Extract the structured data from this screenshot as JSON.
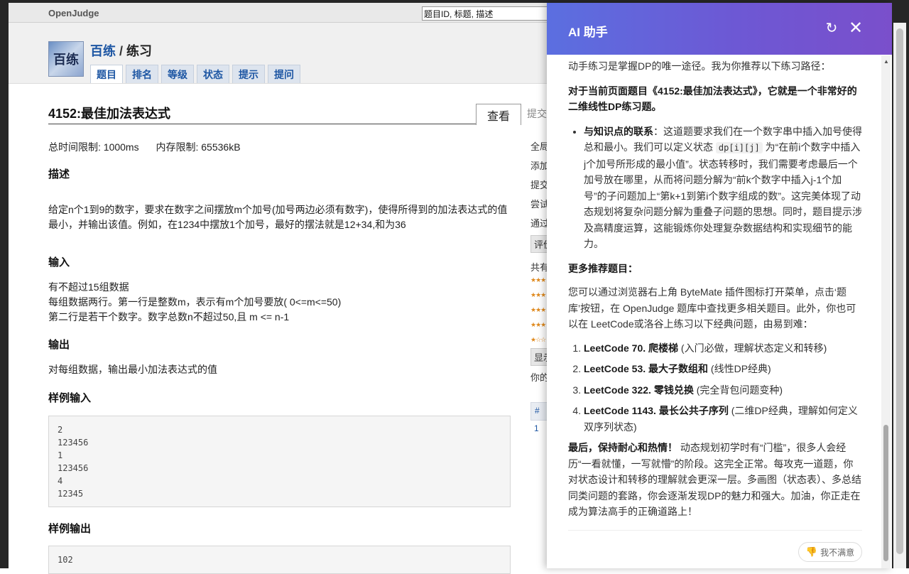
{
  "site": {
    "brand": "OpenJudge",
    "search_placeholder": "题目ID, 标题, 描述"
  },
  "header": {
    "logo_text": "百练",
    "crumb_link": "百练",
    "crumb_sep": "/",
    "crumb_current": "练习",
    "tabs": [
      "题目",
      "排名",
      "等级",
      "状态",
      "提示",
      "提问"
    ]
  },
  "problem": {
    "title": "4152:最佳加法表达式",
    "view_tab": "查看",
    "next_tab": "提交",
    "time_limit": "总时间限制: 1000ms",
    "memory_limit": "内存限制: 65536kB",
    "desc_h": "描述",
    "desc": "给定n个1到9的数字，要求在数字之间摆放m个加号(加号两边必须有数字)，使得所得到的加法表达式的值最小，并输出该值。例如，在1234中摆放1个加号，最好的摆法就是12+34,和为36",
    "input_h": "输入",
    "input_lines": [
      "有不超过15组数据",
      "每组数据两行。第一行是整数m，表示有m个加号要放( 0<=m<=50)",
      "第二行是若干个数字。数字总数n不超过50,且 m <= n-1"
    ],
    "output_h": "输出",
    "output": "对每组数据，输出最小加法表达式的值",
    "sample_in_h": "样例输入",
    "sample_in": "2\n123456\n1\n123456\n4\n12345",
    "sample_out_h": "样例输出",
    "sample_out": "102"
  },
  "sidebar": {
    "lines": [
      "全局",
      "添加",
      "提交",
      "尝试",
      "通过"
    ],
    "eval_btn": "评价",
    "share_label": "共有",
    "show_btn": "显示",
    "yours_label": "你的",
    "table_head": "#",
    "table_row": "1"
  },
  "ai": {
    "title": "AI 助手",
    "refresh_icon": "↻",
    "close_icon": "✕",
    "intro": "动手练习是掌握DP的唯一途径。我为你推荐以下练习路径：",
    "current_bold": "对于当前页面题目《4152:最佳加法表达式》，它就是一个非常好的二维线性DP练习题。",
    "bullet_bold": "与知识点的联系",
    "bullet_a": "：这道题要求我们在一个数字串中插入加号使得总和最小。我们可以定义状态 ",
    "bullet_code": "dp[i][j]",
    "bullet_b": " 为“在前i个数字中插入j个加号所形成的最小值”。状态转移时，我们需要考虑最后一个加号放在哪里，从而将问题分解为“前k个数字中插入j-1个加号”的子问题加上“第k+1到第i个数字组成的数”。这完美体现了动态规划将复杂问题分解为重叠子问题的思想。同时，题目提示涉及高精度运算，这能锻炼你处理复杂数据结构和实现细节的能力。",
    "more_h": "更多推荐题目：",
    "more_text": "您可以通过浏览器右上角 ByteMate 插件图标打开菜单，点击‘题库’按钮，在 OpenJudge 题库中查找更多相关题目。此外，你也可以在 LeetCode或洛谷上练习以下经典问题，由易到难：",
    "list": [
      {
        "bold": "LeetCode 70. 爬楼梯",
        "rest": " (入门必做，理解状态定义和转移)"
      },
      {
        "bold": "LeetCode 53. 最大子数组和",
        "rest": " (线性DP经典)"
      },
      {
        "bold": "LeetCode 322. 零钱兑换",
        "rest": " (完全背包问题变种)"
      },
      {
        "bold": "LeetCode 1143. 最长公共子序列",
        "rest": " (二维DP经典，理解如何定义双序列状态)"
      }
    ],
    "final_bold": "最后，保持耐心和热情！",
    "final_text": " 动态规划初学时有“门槛”，很多人会经历“一看就懂，一写就懵”的阶段。这完全正常。每攻克一道题，你对状态设计和转移的理解就会更深一层。多画图（状态表）、多总结同类问题的套路，你会逐渐发现DP的魅力和强大。加油，你正走在成为算法高手的正确道路上！",
    "feedback_label": "我不满意",
    "thumb_icon": "👎"
  },
  "colors": {
    "accent": "#1d56a3",
    "ai_header_start": "#5b6fe0",
    "ai_header_end": "#7a4fcb"
  }
}
